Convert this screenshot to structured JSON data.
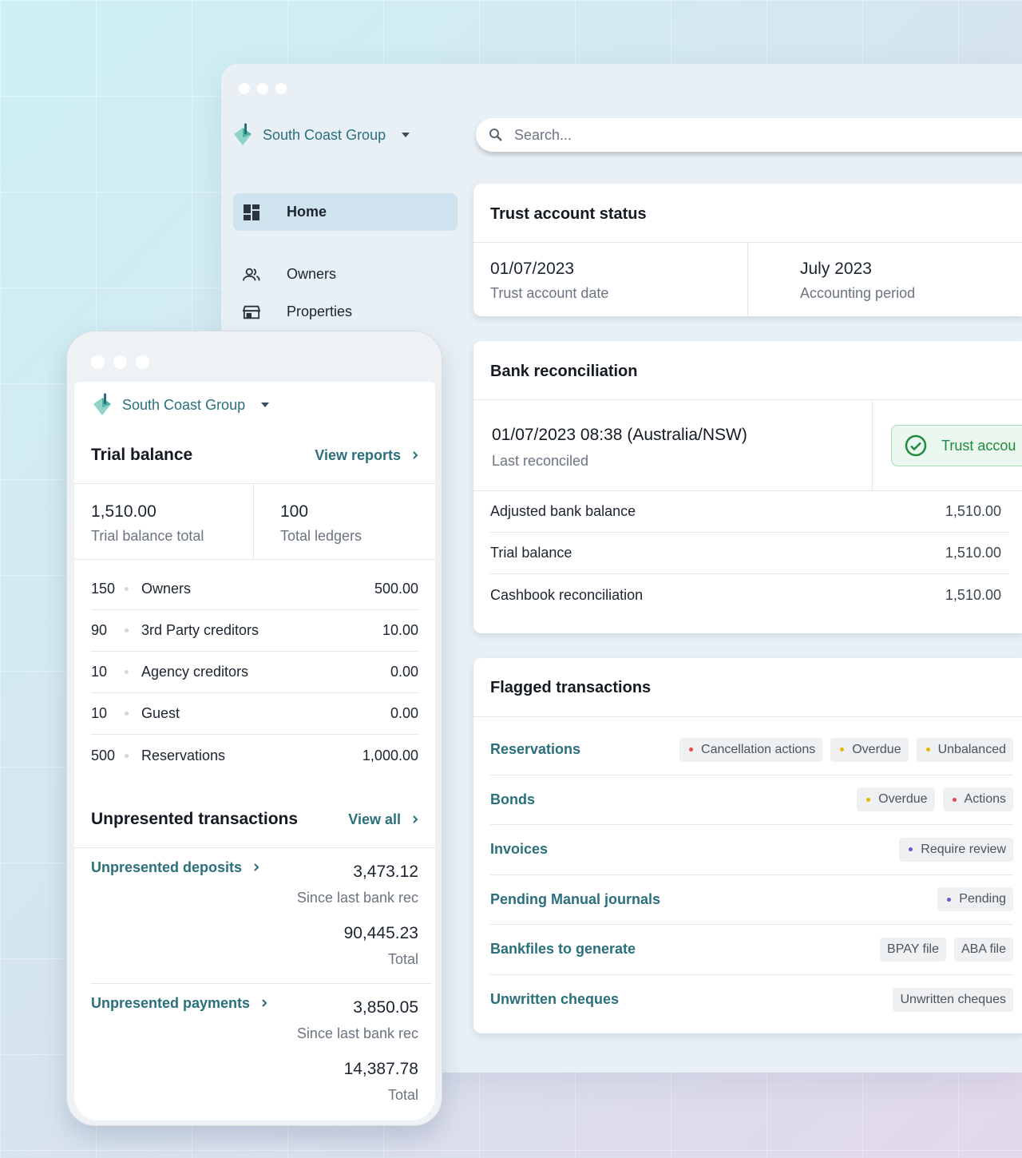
{
  "org": {
    "name": "South Coast Group"
  },
  "search": {
    "placeholder": "Search..."
  },
  "nav": {
    "items": [
      {
        "label": "Home",
        "icon": "dashboard-icon",
        "active": true
      },
      {
        "label": "Owners",
        "icon": "people-icon",
        "active": false
      },
      {
        "label": "Properties",
        "icon": "store-icon",
        "active": false
      }
    ]
  },
  "trust_status": {
    "title": "Trust account status",
    "date_value": "01/07/2023",
    "date_label": "Trust account date",
    "period_value": "July 2023",
    "period_label": "Accounting period"
  },
  "bank_reconciliation": {
    "title": "Bank reconciliation",
    "last_value": "01/07/2023 08:38 (Australia/NSW)",
    "last_label": "Last reconciled",
    "badge_text": "Trust accou",
    "rows": [
      {
        "label": "Adjusted bank balance",
        "value": "1,510.00"
      },
      {
        "label": "Trial balance",
        "value": "1,510.00"
      },
      {
        "label": "Cashbook reconciliation",
        "value": "1,510.00"
      }
    ]
  },
  "flagged": {
    "title": "Flagged transactions",
    "rows": [
      {
        "name": "Reservations",
        "tags": [
          {
            "label": "Cancellation actions",
            "dot": "#e5484d"
          },
          {
            "label": "Overdue",
            "dot": "#e6b800"
          },
          {
            "label": "Unbalanced",
            "dot": "#e6b800"
          }
        ]
      },
      {
        "name": "Bonds",
        "tags": [
          {
            "label": "Overdue",
            "dot": "#e6b800"
          },
          {
            "label": "Actions",
            "dot": "#e5484d"
          }
        ]
      },
      {
        "name": "Invoices",
        "tags": [
          {
            "label": "Require review",
            "dot": "#6e56cf"
          }
        ]
      },
      {
        "name": "Pending Manual journals",
        "tags": [
          {
            "label": "Pending",
            "dot": "#6e56cf"
          }
        ]
      },
      {
        "name": "Bankfiles to generate",
        "tags": [
          {
            "label": "BPAY file",
            "dot": ""
          },
          {
            "label": "ABA file",
            "dot": ""
          }
        ]
      },
      {
        "name": "Unwritten cheques",
        "tags": [
          {
            "label": "Unwritten cheques",
            "dot": ""
          }
        ]
      }
    ]
  },
  "mobile": {
    "trial_balance": {
      "title": "Trial balance",
      "link": "View reports",
      "total_value": "1,510.00",
      "total_label": "Trial balance total",
      "ledgers_value": "100",
      "ledgers_label": "Total ledgers",
      "rows": [
        {
          "code": "150",
          "name": "Owners",
          "amount": "500.00"
        },
        {
          "code": "90",
          "name": "3rd Party creditors",
          "amount": "10.00"
        },
        {
          "code": "10",
          "name": "Agency creditors",
          "amount": "0.00"
        },
        {
          "code": "10",
          "name": "Guest",
          "amount": "0.00"
        },
        {
          "code": "500",
          "name": "Reservations",
          "amount": "1,000.00"
        }
      ]
    },
    "unpresented": {
      "title": "Unpresented transactions",
      "link": "View all",
      "deposits": {
        "label": "Unpresented deposits",
        "since_value": "3,473.12",
        "since_label": "Since last bank rec",
        "total_value": "90,445.23",
        "total_label": "Total"
      },
      "payments": {
        "label": "Unpresented payments",
        "since_value": "3,850.05",
        "since_label": "Since last bank rec",
        "total_value": "14,387.78",
        "total_label": "Total"
      }
    }
  },
  "colors": {
    "accent": "#2a6f7c",
    "success": "#1f8a3d",
    "nav_active": "#cfe3ee"
  }
}
